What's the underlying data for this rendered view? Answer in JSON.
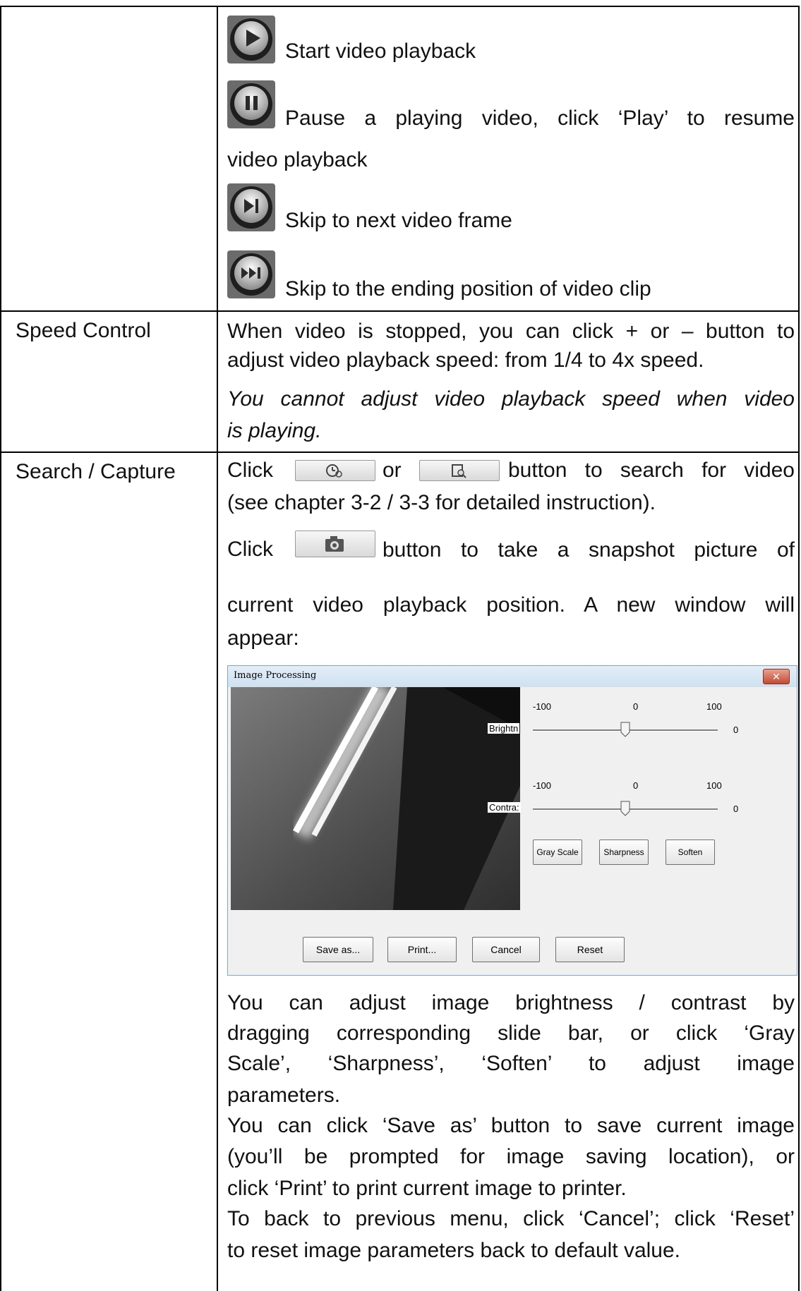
{
  "rows": {
    "playback": {
      "items": [
        {
          "icon": "play-icon",
          "text": "Start video playback"
        },
        {
          "icon": "pause-icon",
          "text_line1": "Pause a playing video, click ‘Play’ to resume",
          "text_line2": "video playback"
        },
        {
          "icon": "next-frame-icon",
          "text": "Skip to next video frame"
        },
        {
          "icon": "skip-to-end-icon",
          "text": "Skip to the ending position of video clip"
        }
      ]
    },
    "speed": {
      "label": "Speed Control",
      "line1": "When video is stopped, you can click + or – button to",
      "line2": "adjust video playback speed: from 1/4 to 4x speed.",
      "line3": "You cannot adjust video playback speed when video",
      "line4": "is playing."
    },
    "search": {
      "label": "Search / Capture",
      "click1": "Click",
      "or": "or",
      "search_rest": "button to search for video",
      "search_line2": "(see chapter 3-2 / 3-3 for detailed instruction).",
      "click2": "Click",
      "snapshot_rest": "button to take a snapshot picture of",
      "snapshot_line2": "current video playback position. A new window will",
      "snapshot_line3": "appear:",
      "desc1_l1": "You can adjust image brightness / contrast by",
      "desc1_l2": "dragging corresponding slide bar, or click ‘Gray",
      "desc1_l3": "Scale’, ‘Sharpness’, ‘Soften’ to adjust image",
      "desc1_l4": "parameters.",
      "desc2_l1": "You can click ‘Save as’ button to save current image",
      "desc2_l2": "(you’ll be prompted for image saving location), or",
      "desc2_l3": "click ‘Print’ to print current image to printer.",
      "desc3_l1": "To back to previous menu, click ‘Cancel’; click ‘Reset’",
      "desc3_l2": "to reset image parameters back to default value."
    }
  },
  "dialog": {
    "title": "Image Processing",
    "close_icon": "close-icon",
    "brightness": {
      "label": "Brightn",
      "min": "-100",
      "mid": "0",
      "max": "100",
      "value": "0",
      "level": 0
    },
    "contrast": {
      "label": "Contra:",
      "min": "-100",
      "mid": "0",
      "max": "100",
      "value": "0",
      "level": 0
    },
    "effects": [
      "Gray Scale",
      "Sharpness",
      "Soften"
    ],
    "actions": [
      "Save as...",
      "Print...",
      "Cancel",
      "Reset"
    ]
  },
  "colors": {
    "border": "#000000",
    "dialog_frame": "#7fa6c9",
    "close_button": "#c44a32"
  }
}
